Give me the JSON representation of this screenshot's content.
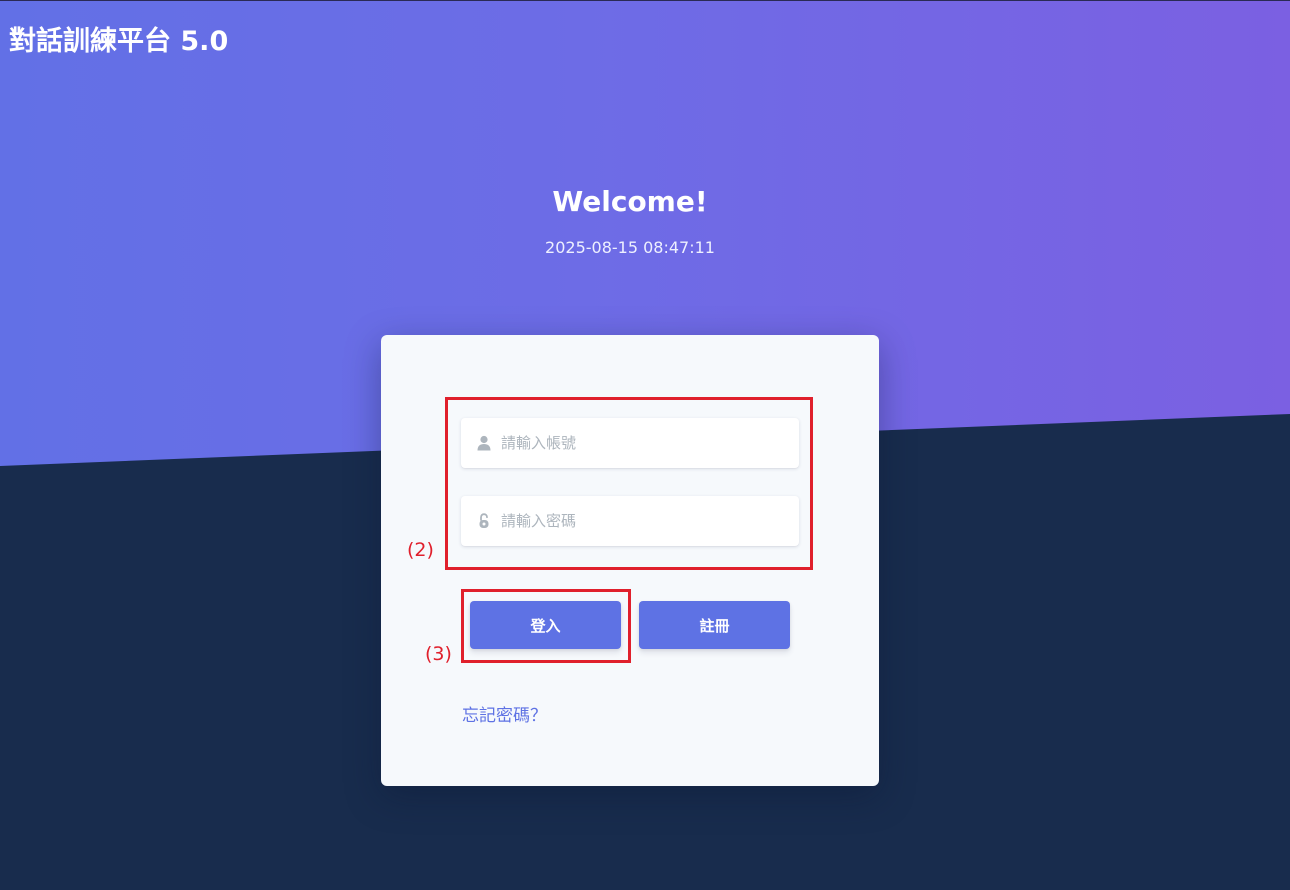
{
  "app": {
    "title": "對話訓練平台 5.0"
  },
  "hero": {
    "welcome": "Welcome!",
    "datetime": "2025-08-15 08:47:11"
  },
  "login_form": {
    "username_placeholder": "請輸入帳號",
    "password_placeholder": "請輸入密碼",
    "username_value": "",
    "password_value": "",
    "login_label": "登入",
    "register_label": "註冊",
    "forgot_label": "忘記密碼？",
    "icons": {
      "username": "user-icon",
      "password": "lock-icon"
    }
  },
  "annotations": {
    "fields_label": "(2)",
    "login_label": "(3)"
  },
  "colors": {
    "gradient_start": "#6270e6",
    "gradient_end": "#7b60e2",
    "bottom_bg": "#182c4d",
    "accent": "#5e72e4",
    "annotation": "#e0202c"
  }
}
